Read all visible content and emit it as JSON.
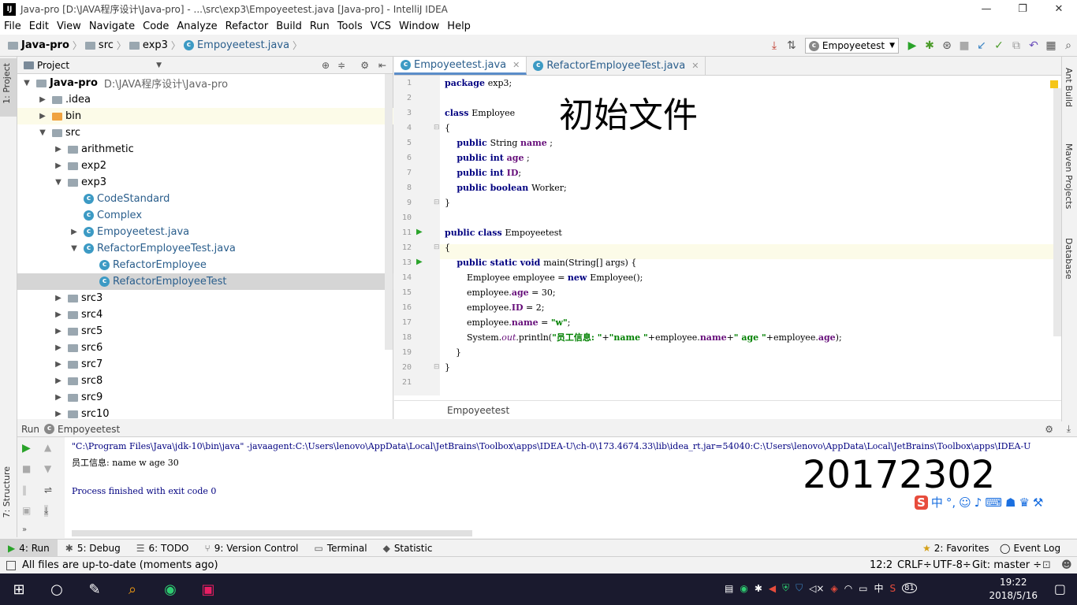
{
  "window": {
    "title": "Java-pro [D:\\JAVA程序设计\\Java-pro] - ...\\src\\exp3\\Empoyeetest.java [Java-pro] - IntelliJ IDEA",
    "app_icon": "IJ"
  },
  "menu": [
    "File",
    "Edit",
    "View",
    "Navigate",
    "Code",
    "Analyze",
    "Refactor",
    "Build",
    "Run",
    "Tools",
    "VCS",
    "Window",
    "Help"
  ],
  "breadcrumb": {
    "project": "Java-pro",
    "src": "src",
    "pkg": "exp3",
    "file": "Empoyeetest.java"
  },
  "run_config": "Empoyeetest",
  "left_tabs": {
    "project": "1: Project",
    "structure": "7: Structure"
  },
  "right_tabs": {
    "ant": "Ant Build",
    "maven": "Maven Projects",
    "database": "Database"
  },
  "project_panel": {
    "title": "Project"
  },
  "tree": [
    {
      "label": "Java-pro",
      "extra": "D:\\JAVA程序设计\\Java-pro",
      "indent": 0,
      "arrow": "▼",
      "icon": "folder",
      "bold": true
    },
    {
      "label": ".idea",
      "indent": 1,
      "arrow": "▶",
      "icon": "folder"
    },
    {
      "label": "bin",
      "indent": 1,
      "arrow": "▶",
      "icon": "folder-orange",
      "hl": true
    },
    {
      "label": "src",
      "indent": 1,
      "arrow": "▼",
      "icon": "folder"
    },
    {
      "label": "arithmetic",
      "indent": 2,
      "arrow": "▶",
      "icon": "folder"
    },
    {
      "label": "exp2",
      "indent": 2,
      "arrow": "▶",
      "icon": "folder"
    },
    {
      "label": "exp3",
      "indent": 2,
      "arrow": "▼",
      "icon": "folder"
    },
    {
      "label": "CodeStandard",
      "indent": 3,
      "arrow": "",
      "icon": "class"
    },
    {
      "label": "Complex",
      "indent": 3,
      "arrow": "",
      "icon": "class"
    },
    {
      "label": "Empoyeetest.java",
      "indent": 3,
      "arrow": "▶",
      "icon": "class"
    },
    {
      "label": "RefactorEmployeeTest.java",
      "indent": 3,
      "arrow": "▼",
      "icon": "class"
    },
    {
      "label": "RefactorEmployee",
      "indent": 4,
      "arrow": "",
      "icon": "class"
    },
    {
      "label": "RefactorEmployeeTest",
      "indent": 4,
      "arrow": "",
      "icon": "class",
      "sel": true
    },
    {
      "label": "src3",
      "indent": 2,
      "arrow": "▶",
      "icon": "folder"
    },
    {
      "label": "src4",
      "indent": 2,
      "arrow": "▶",
      "icon": "folder"
    },
    {
      "label": "src5",
      "indent": 2,
      "arrow": "▶",
      "icon": "folder"
    },
    {
      "label": "src6",
      "indent": 2,
      "arrow": "▶",
      "icon": "folder"
    },
    {
      "label": "src7",
      "indent": 2,
      "arrow": "▶",
      "icon": "folder"
    },
    {
      "label": "src8",
      "indent": 2,
      "arrow": "▶",
      "icon": "folder"
    },
    {
      "label": "src9",
      "indent": 2,
      "arrow": "▶",
      "icon": "folder"
    },
    {
      "label": "src10",
      "indent": 2,
      "arrow": "▶",
      "icon": "folder"
    }
  ],
  "editor_tabs": [
    {
      "label": "Empoyeetest.java",
      "active": true
    },
    {
      "label": "RefactorEmployeeTest.java",
      "active": false
    }
  ],
  "overlay_title": "初始文件",
  "code_lines": [
    [
      [
        "kw",
        "package "
      ],
      [
        "",
        "exp3;"
      ]
    ],
    [],
    [
      [
        "kw",
        "class "
      ],
      [
        "",
        "Employee"
      ]
    ],
    [
      [
        "",
        "{"
      ]
    ],
    [
      [
        "kw",
        "    public "
      ],
      [
        "",
        "String "
      ],
      [
        "fld",
        "name"
      ],
      [
        "",
        " ;"
      ]
    ],
    [
      [
        "kw",
        "    public int "
      ],
      [
        "fld",
        "age"
      ],
      [
        "",
        " ;"
      ]
    ],
    [
      [
        "kw",
        "    public int "
      ],
      [
        "fld",
        "ID"
      ],
      [
        "",
        ";"
      ]
    ],
    [
      [
        "kw",
        "    public boolean "
      ],
      [
        "",
        "Worker;"
      ]
    ],
    [
      [
        "",
        "}"
      ]
    ],
    [],
    [
      [
        "kw",
        "public class "
      ],
      [
        "",
        "Empoyeetest"
      ]
    ],
    [
      [
        "",
        "{"
      ]
    ],
    [
      [
        "kw",
        "    public static void "
      ],
      [
        "",
        "main(String[] args) {"
      ]
    ],
    [
      [
        "",
        "        Employee employee = "
      ],
      [
        "kw",
        "new "
      ],
      [
        "",
        "Employee();"
      ]
    ],
    [
      [
        "",
        "        employee."
      ],
      [
        "fld",
        "age"
      ],
      [
        "",
        " = 30;"
      ]
    ],
    [
      [
        "",
        "        employee."
      ],
      [
        "fld",
        "ID"
      ],
      [
        "",
        " = 2;"
      ]
    ],
    [
      [
        "",
        "        employee."
      ],
      [
        "fld",
        "name"
      ],
      [
        "",
        " = "
      ],
      [
        "str",
        "\"w\""
      ],
      [
        "",
        ";"
      ]
    ],
    [
      [
        "",
        "        System."
      ],
      [
        "it",
        "out"
      ],
      [
        "",
        ".println("
      ],
      [
        "str",
        "\"员工信息: \""
      ],
      [
        "",
        "+"
      ],
      [
        "str",
        "\"name \""
      ],
      [
        "",
        "+employee."
      ],
      [
        "fld",
        "name"
      ],
      [
        "",
        "+"
      ],
      [
        "str",
        "\" age \""
      ],
      [
        "",
        "+employee."
      ],
      [
        "fld",
        "age"
      ],
      [
        "",
        ");"
      ]
    ],
    [
      [
        "",
        "    }"
      ]
    ],
    [
      [
        "",
        "}"
      ]
    ],
    []
  ],
  "editor_crumb": "Empoyeetest",
  "run_panel": {
    "label": "Run",
    "config": "Empoyeetest",
    "cmd": "\"C:\\Program Files\\Java\\jdk-10\\bin\\java\" -javaagent:C:\\Users\\lenovo\\AppData\\Local\\JetBrains\\Toolbox\\apps\\IDEA-U\\ch-0\\173.4674.33\\lib\\idea_rt.jar=54040:C:\\Users\\lenovo\\AppData\\Local\\JetBrains\\Toolbox\\apps\\IDEA-U",
    "output": "员工信息: name w age 30",
    "exit": "Process finished with exit code 0",
    "student_id": "20172302"
  },
  "bottom_tabs": [
    "4: Run",
    "5: Debug",
    "6: TODO",
    "9: Version Control",
    "Terminal",
    "Statistic"
  ],
  "bottom_right": {
    "favorites": "2: Favorites",
    "event_log": "Event Log"
  },
  "status": {
    "message": "All files are up-to-date (moments ago)",
    "pos": "12:2",
    "crlf": "CRLF÷",
    "enc": "UTF-8÷",
    "git": "Git: master ÷"
  },
  "taskbar": {
    "time": "19:22",
    "date": "2018/5/16",
    "ime": "中",
    "battery": "81"
  }
}
